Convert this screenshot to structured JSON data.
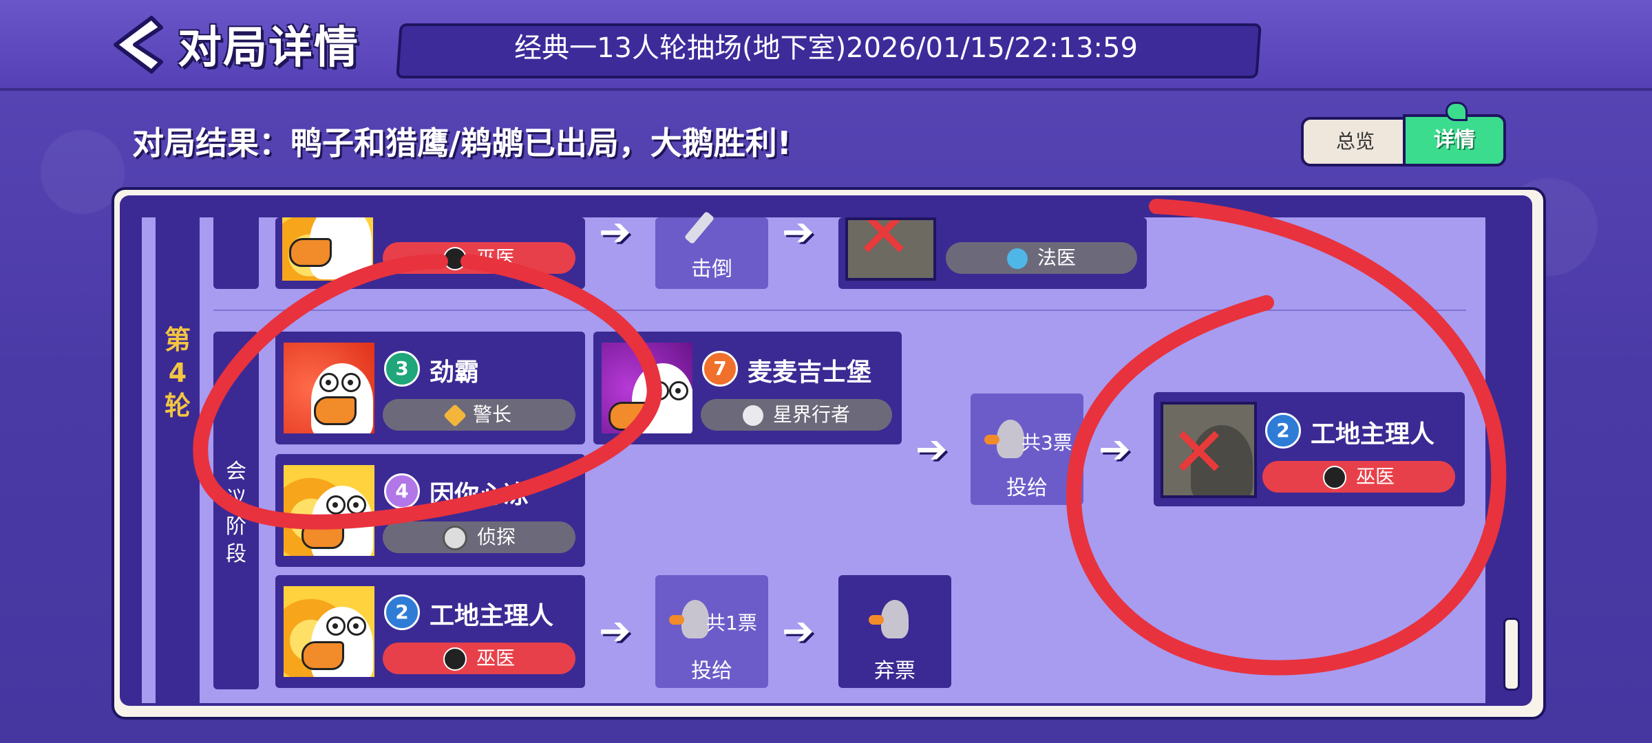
{
  "header": {
    "title": "对局详情",
    "match_info": "经典一13人轮抽场(地下室)2026/01/15/22:13:59"
  },
  "result_text": "对局结果：鸭子和猎鹰/鹈鹕已出局，大鹅胜利!",
  "view_toggle": {
    "overview": "总览",
    "details": "详情",
    "active": "details"
  },
  "round": {
    "label": [
      "第",
      "4",
      "轮"
    ]
  },
  "phase": {
    "label": [
      "会",
      "议",
      "阶",
      "段"
    ]
  },
  "previous_round_row": {
    "attacker_role": "巫医",
    "action": "击倒",
    "victim_badge": "",
    "victim_role": "法医"
  },
  "meeting": {
    "players": [
      {
        "number": "3",
        "name": "劲霸",
        "role": "警长",
        "badge_color": "#1fa67a"
      },
      {
        "number": "7",
        "name": "麦麦吉士堡",
        "role": "星界行者",
        "badge_color": "#f0702c"
      },
      {
        "number": "4",
        "name": "因你心冻",
        "role": "侦探",
        "badge_color": "#b176e8"
      }
    ],
    "vote_result": {
      "count": "共3票",
      "action": "投给",
      "target": {
        "number": "2",
        "name": "工地主理人",
        "role": "巫医"
      }
    },
    "self_vote": {
      "player": {
        "number": "2",
        "name": "工地主理人",
        "role": "巫医"
      },
      "count": "共1票",
      "action": "投给",
      "outcome": "弃票"
    }
  },
  "colors": {
    "accent_green": "#3bdc8d",
    "role_red": "#e8404a",
    "round_label": "#f4c542",
    "annotation_red": "#e8323e"
  }
}
